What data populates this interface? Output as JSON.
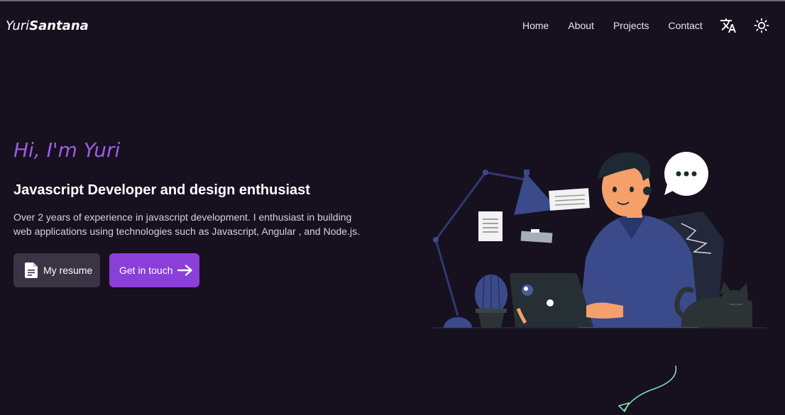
{
  "brand": {
    "first": "Yuri",
    "last": "Santana"
  },
  "nav": {
    "links": [
      "Home",
      "About",
      "Projects",
      "Contact"
    ],
    "translate_icon": "translate-icon",
    "theme_icon": "sun-icon"
  },
  "hero": {
    "greeting": "Hi, I'm Yuri",
    "headline": "Javascript Developer and design enthusiast",
    "description": "Over 2 years of experience in javascript development. I enthusiast in building web applications using technologies such as Javascript, Angular , and Node.js.",
    "resume_label": "My resume",
    "resume_icon": "document-icon",
    "contact_label": "Get in touch",
    "contact_icon": "arrow-right-icon"
  },
  "colors": {
    "background": "#16101f",
    "accent": "#8a3fd9",
    "greeting": "#9b5de5",
    "secondary_button": "#3a3445"
  }
}
